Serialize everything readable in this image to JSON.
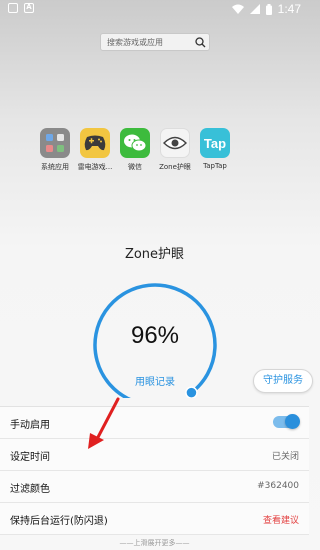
{
  "status_bar": {
    "left_icons": [
      "notification-box-icon",
      "A"
    ],
    "right_icons": [
      "wifi-icon",
      "signal-icon",
      "battery-icon"
    ],
    "time": "1:47"
  },
  "search": {
    "placeholder": "搜索游戏或应用"
  },
  "apps": [
    {
      "label": "系统应用",
      "icon": "system-apps-icon"
    },
    {
      "label": "雷电游戏...",
      "icon": "gamepad-icon"
    },
    {
      "label": "微信",
      "icon": "wechat-icon"
    },
    {
      "label": "Zone护眼",
      "icon": "eye-icon"
    },
    {
      "label": "TapTap",
      "icon": "taptap-icon",
      "icon_text": "Tap"
    }
  ],
  "main": {
    "title": "Zone护眼",
    "percent": "96%",
    "gauge_value": 0.96,
    "eye_record": "用眼记录",
    "guard_button": "守护服务"
  },
  "settings": [
    {
      "label": "手动启用",
      "type": "toggle",
      "value": true
    },
    {
      "label": "设定时间",
      "type": "value",
      "value": "已关闭"
    },
    {
      "label": "过滤颜色",
      "type": "value",
      "value": "#362400"
    },
    {
      "label": "保持后台运行(防闪退)",
      "type": "link",
      "value": "查看建议"
    }
  ],
  "footer": "——上滑展开更多——",
  "colors": {
    "accent": "#2a93e0",
    "warning_link": "#e34040",
    "annotation_arrow": "#e02020"
  }
}
